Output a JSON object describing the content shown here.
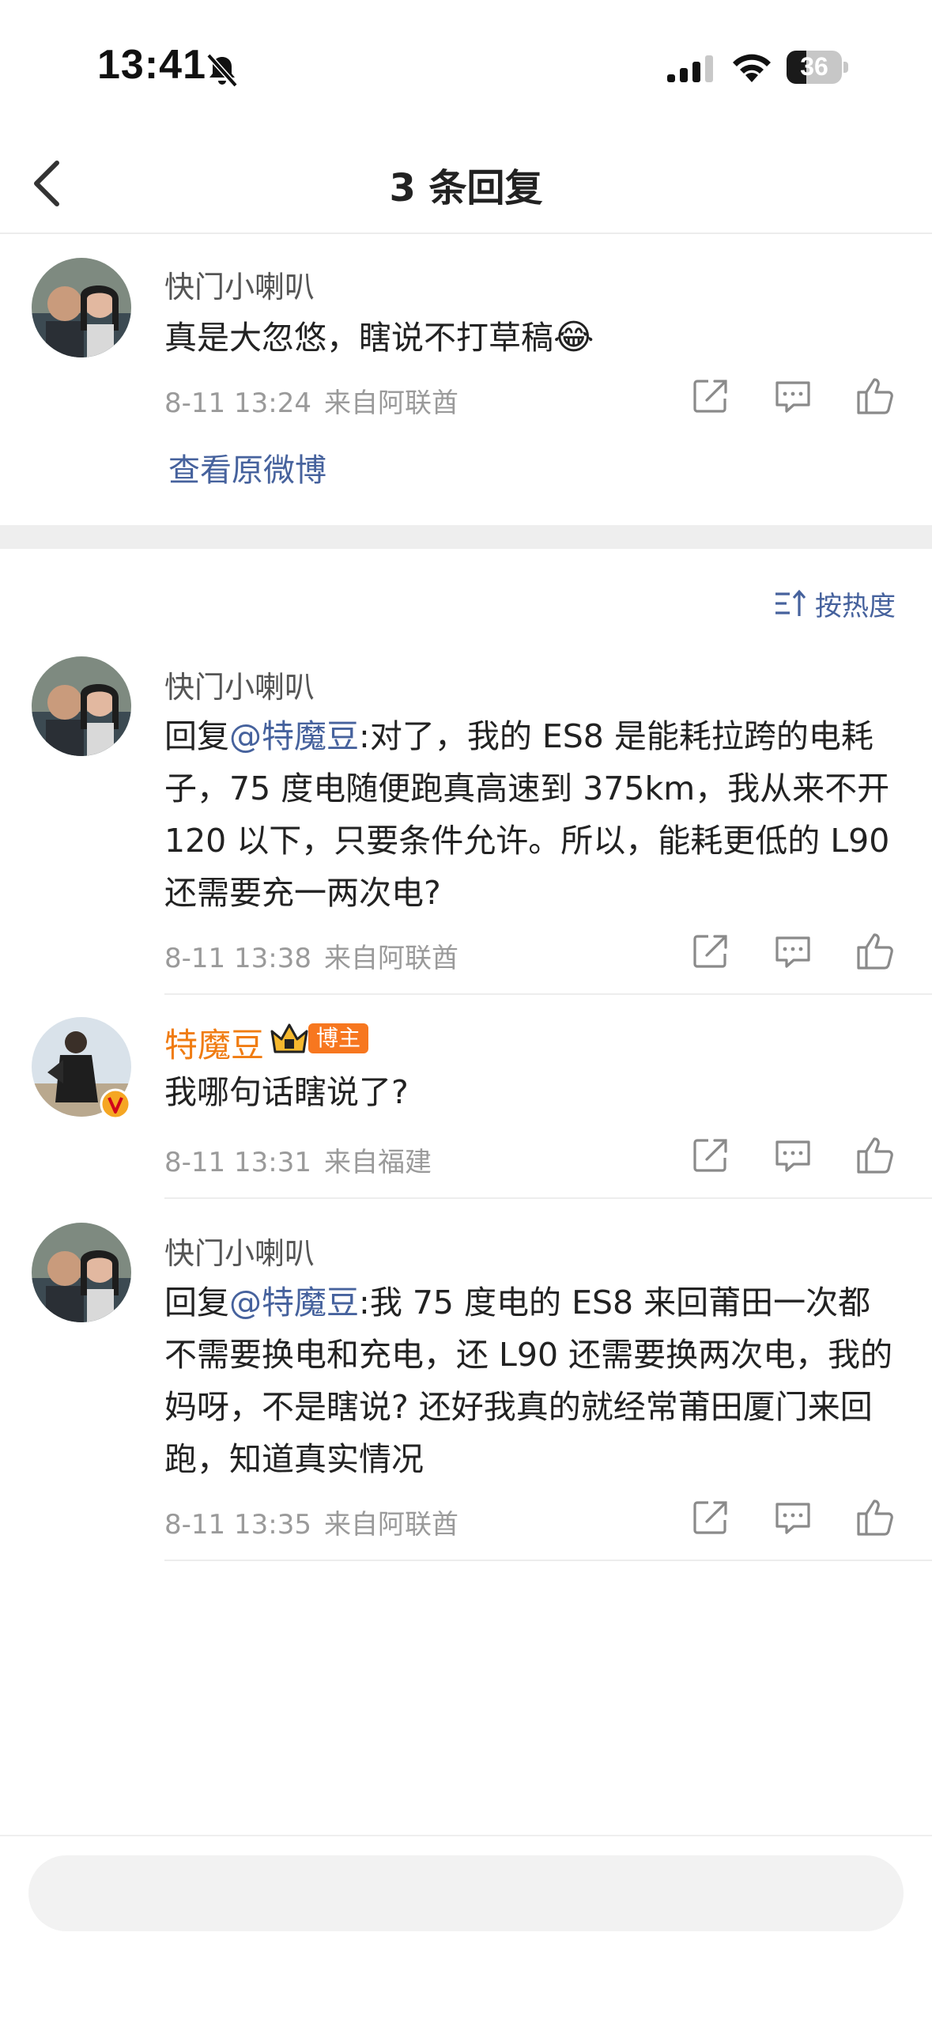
{
  "status_bar": {
    "time": "13:41",
    "battery": "36",
    "battery_level": 0.36
  },
  "nav": {
    "title": "3 条回复"
  },
  "original": {
    "user": "快门小喇叭",
    "text": "真是大忽悠，瞎说不打草稿",
    "emoji": "😂",
    "time": "8-11 13:24",
    "location": "来自阿联酋",
    "view_original": "查看原微博"
  },
  "sort_label": "按热度",
  "replies": [
    {
      "user": "快门小喇叭",
      "prefix": "回复",
      "mention": "@特魔豆",
      "text": ":对了，我的 ES8 是能耗拉跨的电耗子，75 度电随便跑真高速到 375km，我从来不开 120 以下，只要条件允许。所以，能耗更低的 L90 还需要充一两次电?",
      "time": "8-11 13:38",
      "location": "来自阿联酋"
    },
    {
      "user": "特魔豆",
      "badge": "博主",
      "text": "我哪句话瞎说了?",
      "time": "8-11 13:31",
      "location": "来自福建"
    },
    {
      "user": "快门小喇叭",
      "prefix": "回复",
      "mention": "@特魔豆",
      "text": ":我 75 度电的 ES8 来回莆田一次都不需要换电和充电，还 L90 还需要换两次电，我的妈呀，不是瞎说? 还好我真的就经常莆田厦门来回跑，知道真实情况",
      "time": "8-11 13:35",
      "location": "来自阿联酋"
    }
  ],
  "colors": {
    "link": "#46629d",
    "vip_name": "#f07c12",
    "meta": "#9a9a9a"
  },
  "icons": [
    "back-arrow-icon",
    "share-icon",
    "comment-icon",
    "like-icon",
    "sort-icon",
    "verified-badge-icon",
    "crown-icon"
  ]
}
